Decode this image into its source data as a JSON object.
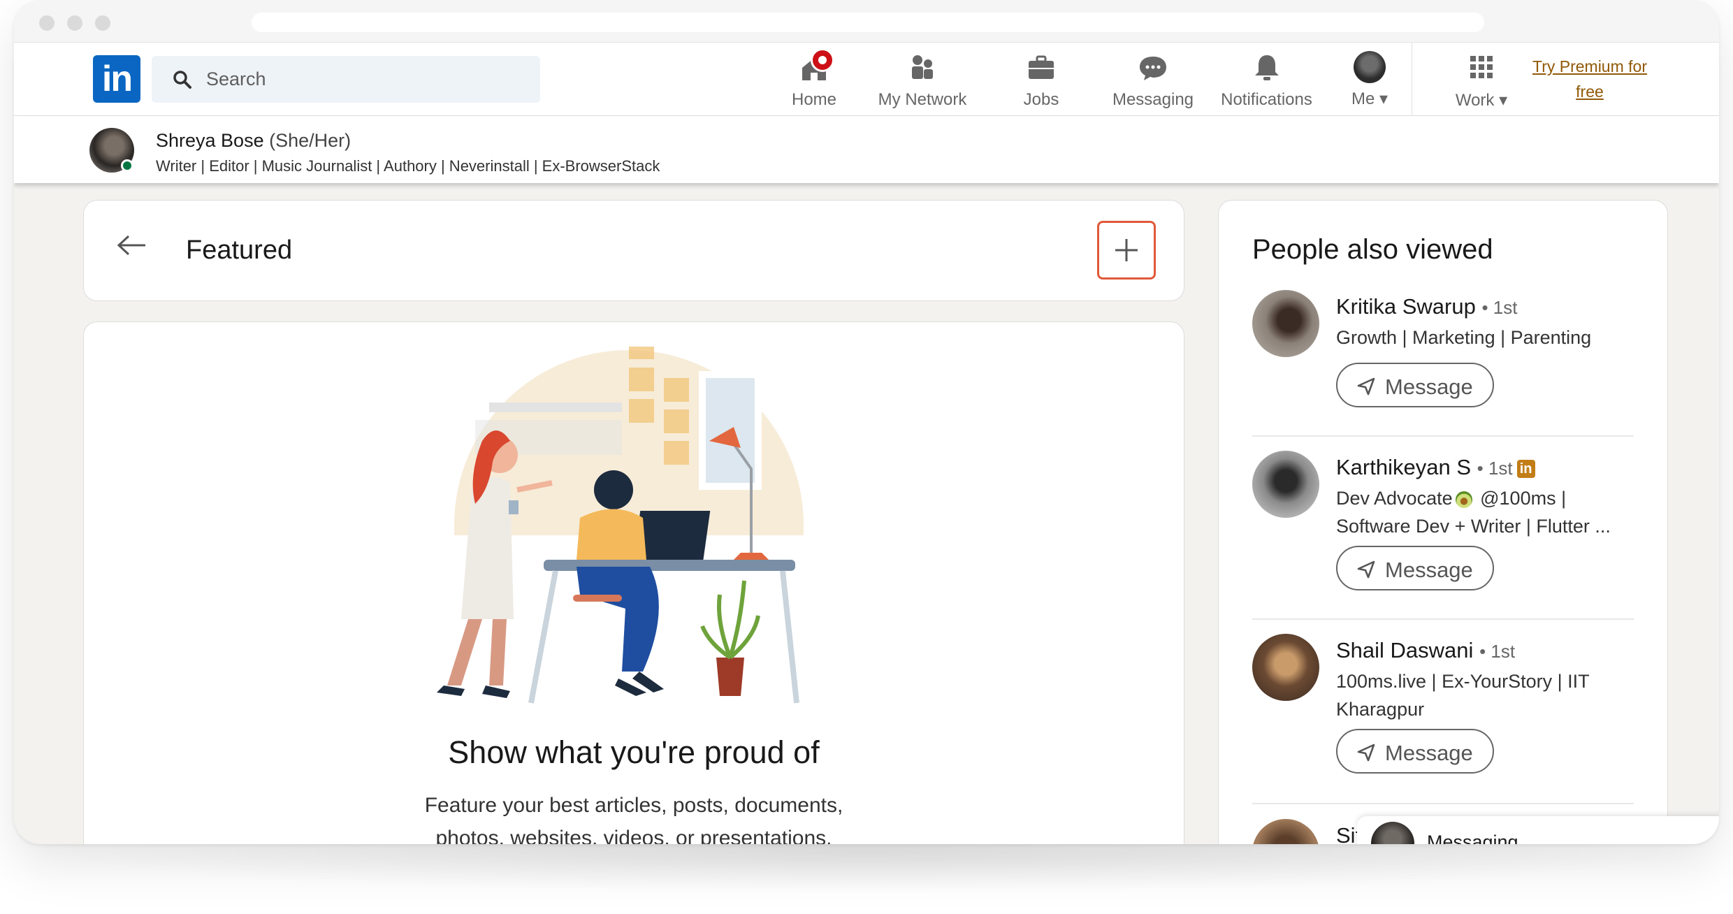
{
  "nav": {
    "logo": "in",
    "search_placeholder": "Search",
    "items": [
      {
        "label": "Home"
      },
      {
        "label": "My Network"
      },
      {
        "label": "Jobs"
      },
      {
        "label": "Messaging"
      },
      {
        "label": "Notifications"
      },
      {
        "label": "Me"
      },
      {
        "label": "Work"
      }
    ],
    "premium_line1": "Try Premium for",
    "premium_line2": "free"
  },
  "profile": {
    "name": "Shreya Bose",
    "pronouns": "(She/Her)",
    "headline": "Writer | Editor | Music Journalist | Authory | Neverinstall | Ex-BrowserStack"
  },
  "featured": {
    "title": "Featured",
    "empty_title": "Show what you're proud of",
    "empty_desc_line1": "Feature your best articles, posts, documents,",
    "empty_desc_line2": "photos, websites, videos, or presentations."
  },
  "people_also_viewed": {
    "title": "People also viewed",
    "message_label": "Message",
    "people": [
      {
        "name": "Kritika Swarup",
        "degree": "• 1st",
        "desc_line1": "Growth | Marketing | Parenting"
      },
      {
        "name": "Karthikeyan S",
        "degree": "• 1st",
        "desc_line1a": "Dev Advocate",
        "desc_line1b": "@100ms |",
        "desc_line2": "Software Dev + Writer | Flutter ..."
      },
      {
        "name": "Shail Daswani",
        "degree": "• 1st",
        "desc_line1": "100ms.live | Ex-YourStory | IIT",
        "desc_line2": "Kharagpur"
      },
      {
        "name": "Sit"
      }
    ]
  },
  "messaging_popup": {
    "label": "Messaging"
  },
  "colors": {
    "brand": "#0a66c2",
    "accent_highlight": "#e0593a",
    "premium": "#915907",
    "online": "#057642",
    "notification": "#cc1016"
  }
}
